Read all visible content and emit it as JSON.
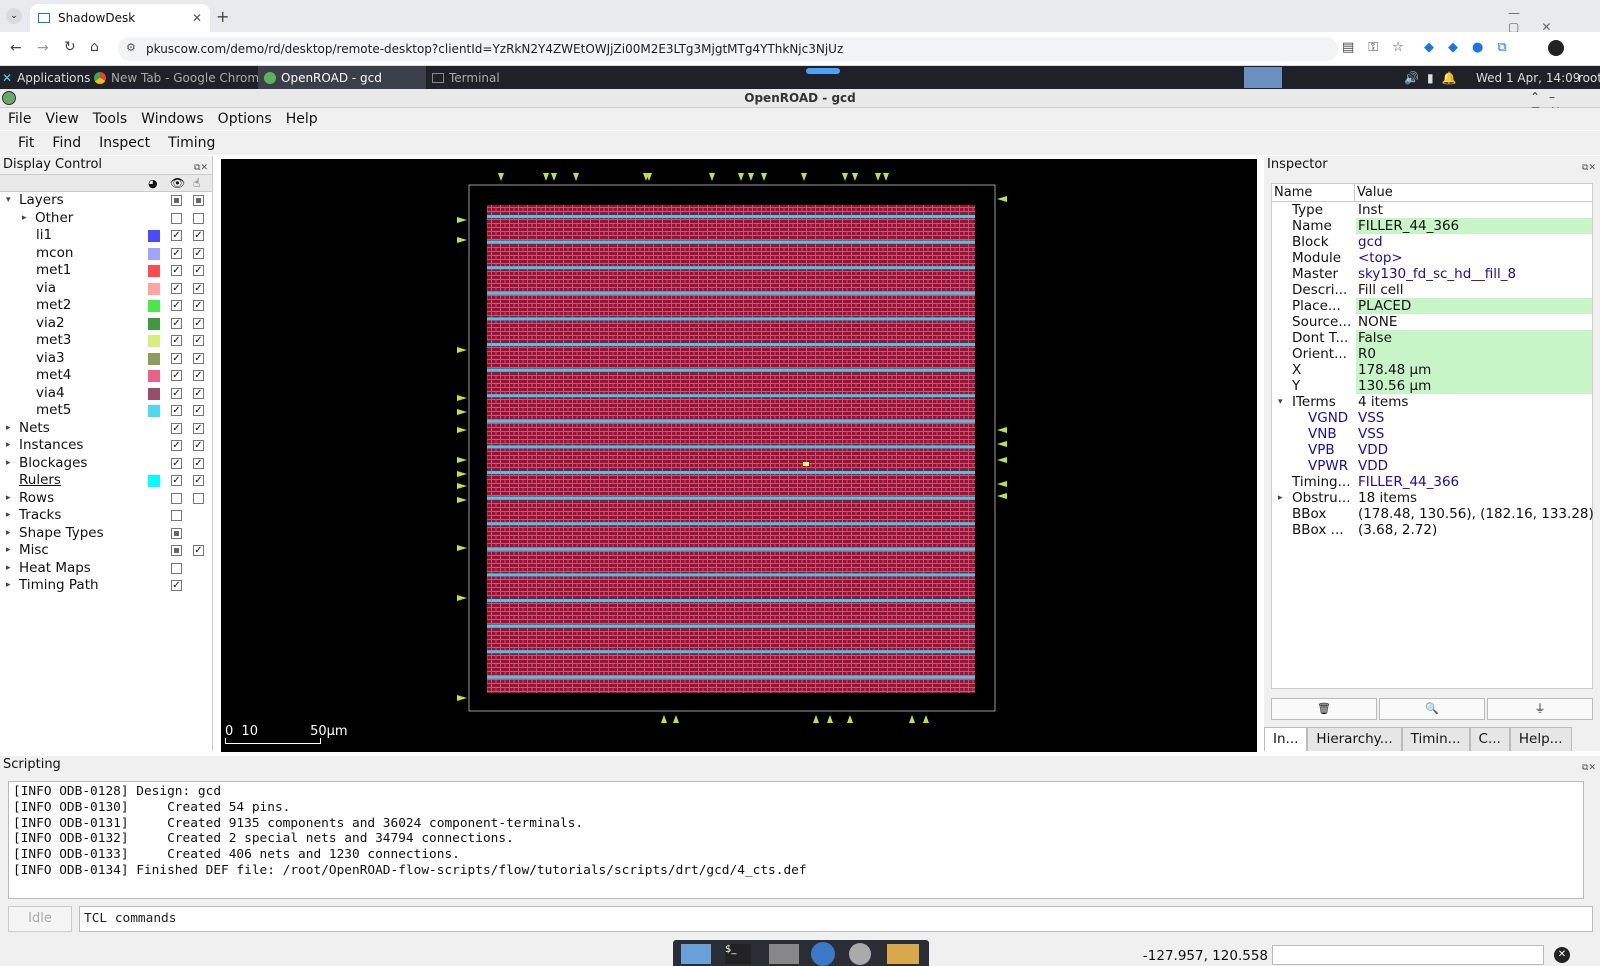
{
  "browser": {
    "tab_title": "ShadowDesk",
    "url": "pkuscow.com/demo/rd/desktop/remote-desktop?clientId=YzRkN2Y4ZWEtOWJjZi00M2E3LTg3MjgtMTg4YThkNjc3NjUz"
  },
  "taskbar": {
    "applications": "Applications",
    "items": [
      "New Tab - Google Chrome",
      "OpenROAD - gcd",
      "Terminal"
    ],
    "clock": "Wed  1 Apr, 14:09",
    "user": "root"
  },
  "window": {
    "title": "OpenROAD - gcd"
  },
  "menu": [
    "File",
    "View",
    "Tools",
    "Windows",
    "Options",
    "Help"
  ],
  "toolbar": [
    "Fit",
    "Find",
    "Inspect",
    "Timing"
  ],
  "display_control": {
    "title": "Display Control",
    "rows": [
      {
        "name": "Layers",
        "indent": 0,
        "expander": "open",
        "v": "ind",
        "s": "ind"
      },
      {
        "name": "Other",
        "indent": 1,
        "expander": "closed",
        "v": "off",
        "s": "off"
      },
      {
        "name": "li1",
        "indent": 2,
        "color": "#4b4bff",
        "v": "on",
        "s": "on"
      },
      {
        "name": "mcon",
        "indent": 2,
        "color": "#a3a3ff",
        "v": "on",
        "s": "on"
      },
      {
        "name": "met1",
        "indent": 2,
        "color": "#ff4b4b",
        "v": "on",
        "s": "on"
      },
      {
        "name": "via",
        "indent": 2,
        "color": "#ffa3a3",
        "v": "on",
        "s": "on"
      },
      {
        "name": "met2",
        "indent": 2,
        "color": "#4be64b",
        "v": "on",
        "s": "on"
      },
      {
        "name": "via2",
        "indent": 2,
        "color": "#3f9a3f",
        "v": "on",
        "s": "on"
      },
      {
        "name": "met3",
        "indent": 2,
        "color": "#d4f07a",
        "v": "on",
        "s": "on"
      },
      {
        "name": "via3",
        "indent": 2,
        "color": "#8f9c5a",
        "v": "on",
        "s": "on"
      },
      {
        "name": "met4",
        "indent": 2,
        "color": "#e8638a",
        "v": "on",
        "s": "on"
      },
      {
        "name": "via4",
        "indent": 2,
        "color": "#974f69",
        "v": "on",
        "s": "on"
      },
      {
        "name": "met5",
        "indent": 2,
        "color": "#4fd8f0",
        "v": "on",
        "s": "on"
      },
      {
        "name": "Nets",
        "indent": 0,
        "expander": "closed",
        "v": "on",
        "s": "on"
      },
      {
        "name": "Instances",
        "indent": 0,
        "expander": "closed",
        "v": "on",
        "s": "on"
      },
      {
        "name": "Blockages",
        "indent": 0,
        "expander": "closed",
        "v": "on",
        "s": "on"
      },
      {
        "name": "Rulers",
        "indent": 0,
        "color": "#00ffff",
        "v": "on",
        "s": "on",
        "underline": true
      },
      {
        "name": "Rows",
        "indent": 0,
        "expander": "closed",
        "v": "off",
        "s": "off"
      },
      {
        "name": "Tracks",
        "indent": 0,
        "expander": "closed",
        "v": "off"
      },
      {
        "name": "Shape Types",
        "indent": 0,
        "expander": "closed",
        "v": "ind"
      },
      {
        "name": "Misc",
        "indent": 0,
        "expander": "closed",
        "v": "ind",
        "s": "on"
      },
      {
        "name": "Heat Maps",
        "indent": 0,
        "expander": "closed",
        "v": "off"
      },
      {
        "name": "Timing Path",
        "indent": 0,
        "expander": "closed",
        "v": "on"
      }
    ]
  },
  "canvas": {
    "scale": [
      "0",
      "10",
      "50μm"
    ]
  },
  "inspector": {
    "title": "Inspector",
    "col_name": "Name",
    "col_value": "Value",
    "rows": [
      {
        "k": "Type",
        "v": "Inst"
      },
      {
        "k": "Name",
        "v": "FILLER_44_366",
        "hl": true
      },
      {
        "k": "Block",
        "v": "gcd",
        "ln": true
      },
      {
        "k": "Module",
        "v": "<top>",
        "ln": true
      },
      {
        "k": "Master",
        "v": "sky130_fd_sc_hd__fill_8",
        "ln": true
      },
      {
        "k": "Descri...",
        "v": "Fill cell"
      },
      {
        "k": "Place...",
        "v": "PLACED",
        "hl": true
      },
      {
        "k": "Source...",
        "v": "NONE"
      },
      {
        "k": "Dont T...",
        "v": "False",
        "hl": true
      },
      {
        "k": "Orient...",
        "v": "R0",
        "hl": true
      },
      {
        "k": "X",
        "v": "178.48 μm",
        "hl": true
      },
      {
        "k": "Y",
        "v": "130.56 μm",
        "hl": true
      },
      {
        "k": "ITerms",
        "v": "4 items",
        "exp": "open"
      },
      {
        "k": "VGND",
        "v": "VSS",
        "ln": true,
        "sub": true
      },
      {
        "k": "VNB",
        "v": "VSS",
        "ln": true,
        "sub": true
      },
      {
        "k": "VPB",
        "v": "VDD",
        "ln": true,
        "sub": true
      },
      {
        "k": "VPWR",
        "v": "VDD",
        "ln": true,
        "sub": true
      },
      {
        "k": "Timing...",
        "v": "FILLER_44_366",
        "ln": true
      },
      {
        "k": "Obstru...",
        "v": "18 items",
        "exp": "closed"
      },
      {
        "k": "BBox",
        "v": "(178.48, 130.56), (182.16, 133.28)"
      },
      {
        "k": "BBox ...",
        "v": "(3.68, 2.72)"
      }
    ],
    "tabs": [
      "In...",
      "Hierarchy...",
      "Timin...",
      "C...",
      "Help..."
    ]
  },
  "scripting": {
    "title": "Scripting",
    "log": [
      "[INFO ODB-0128] Design: gcd",
      "[INFO ODB-0130]     Created 54 pins.",
      "[INFO ODB-0131]     Created 9135 components and 36024 component-terminals.",
      "[INFO ODB-0132]     Created 2 special nets and 34794 connections.",
      "[INFO ODB-0133]     Created 406 nets and 1230 connections.",
      "[INFO ODB-0134] Finished DEF file: /root/OpenROAD-flow-scripts/flow/tutorials/scripts/drt/gcd/4_cts.def"
    ],
    "status": "Idle",
    "placeholder": "TCL commands"
  },
  "status": {
    "coords": "-127.957, 120.558"
  },
  "colors": {
    "core_fill": "#8a1a3a",
    "row_rail": "#3fc8e8",
    "pin": "#b8e830",
    "die_outline": "#9a9a9a"
  }
}
